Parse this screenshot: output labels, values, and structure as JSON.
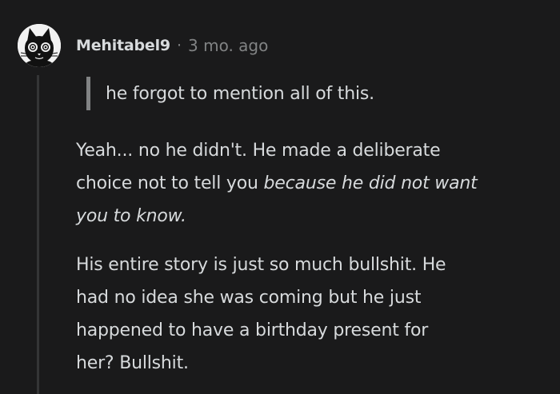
{
  "comment": {
    "author": "Mehitabel9",
    "separator": "·",
    "timestamp": "3 mo. ago",
    "avatar_icon": "cat-face-avatar-icon",
    "quote": "he forgot to mention all of this.",
    "paragraph1": {
      "line1": "Yeah... no he didn't. He made a deliberate",
      "line2_plain": "choice not to tell you ",
      "line2_italic": "because he did not want",
      "line3_italic": "you to know."
    },
    "paragraph2": {
      "line1": "His entire story is just so much bullshit. He",
      "line2": "had no idea she was coming but he just",
      "line3": "happened to have a birthday present for",
      "line4": "her? Bullshit."
    }
  },
  "colors": {
    "background": "#1a1a1b",
    "text": "#d7dadc",
    "muted": "#818384",
    "thread_line": "#343536"
  }
}
